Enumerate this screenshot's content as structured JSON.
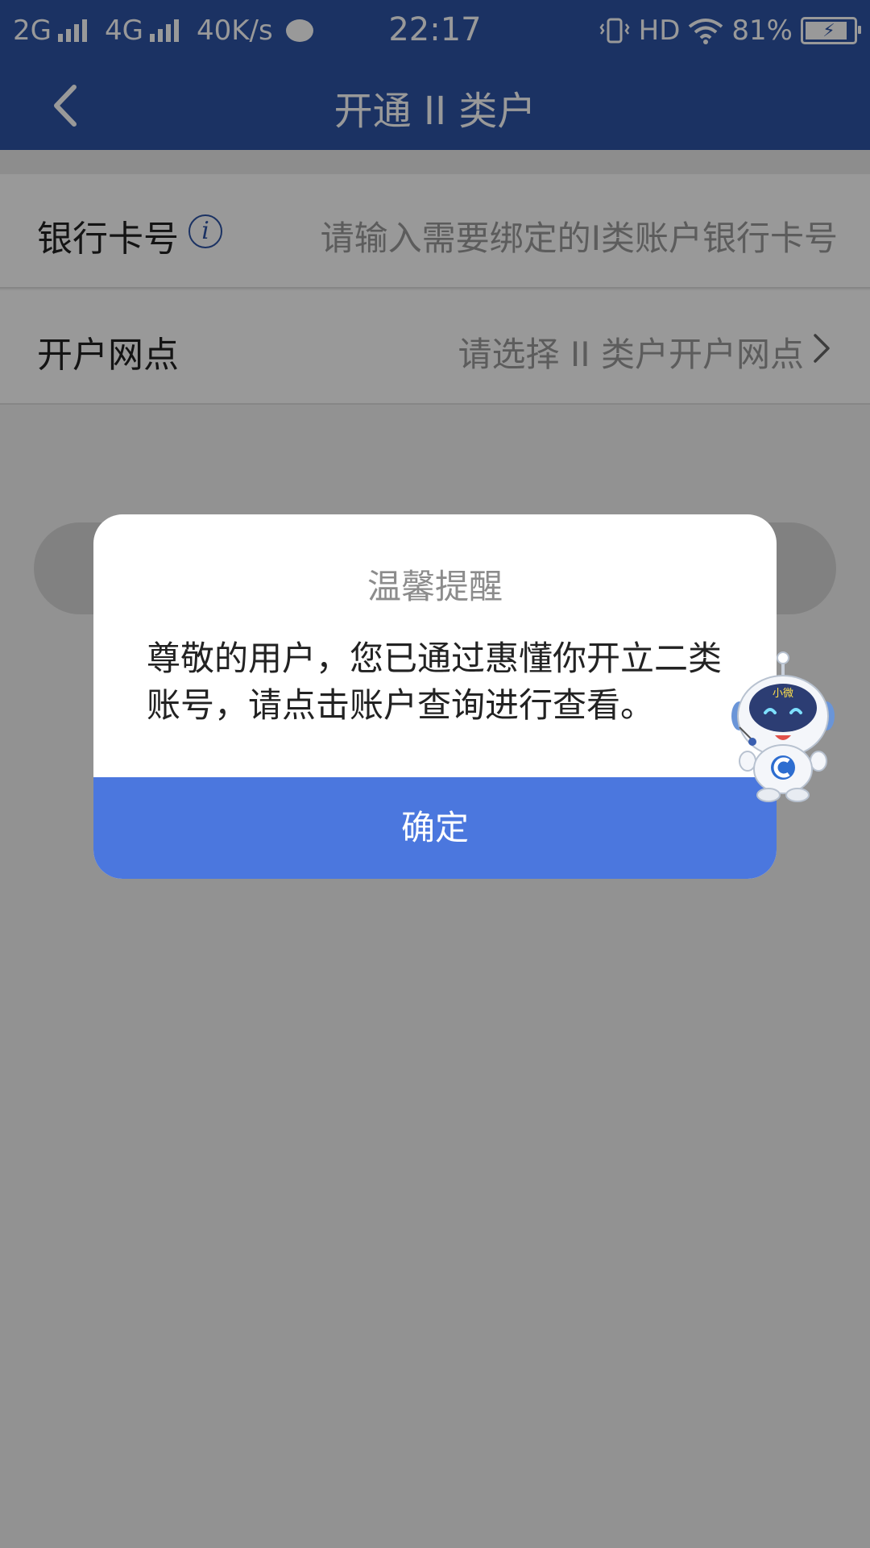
{
  "status_bar": {
    "net1": "2G",
    "net2": "4G",
    "speed": "40K/s",
    "time": "22:17",
    "hd": "HD",
    "battery": "81%"
  },
  "nav": {
    "title": "开通 II 类户"
  },
  "form": {
    "card_label": "银行卡号",
    "card_info_icon": "i",
    "card_placeholder": "请输入需要绑定的I类账户银行卡号",
    "branch_label": "开户网点",
    "branch_placeholder": "请选择 II 类户开户网点"
  },
  "dialog": {
    "title": "温馨提醒",
    "message": "尊敬的用户，您已通过惠懂你开立二类账号，请点击账户查询进行查看。",
    "confirm": "确定"
  },
  "mascot": {
    "badge": "小微"
  },
  "colors": {
    "brand": "#2d54a6",
    "button": "#4b77de"
  }
}
